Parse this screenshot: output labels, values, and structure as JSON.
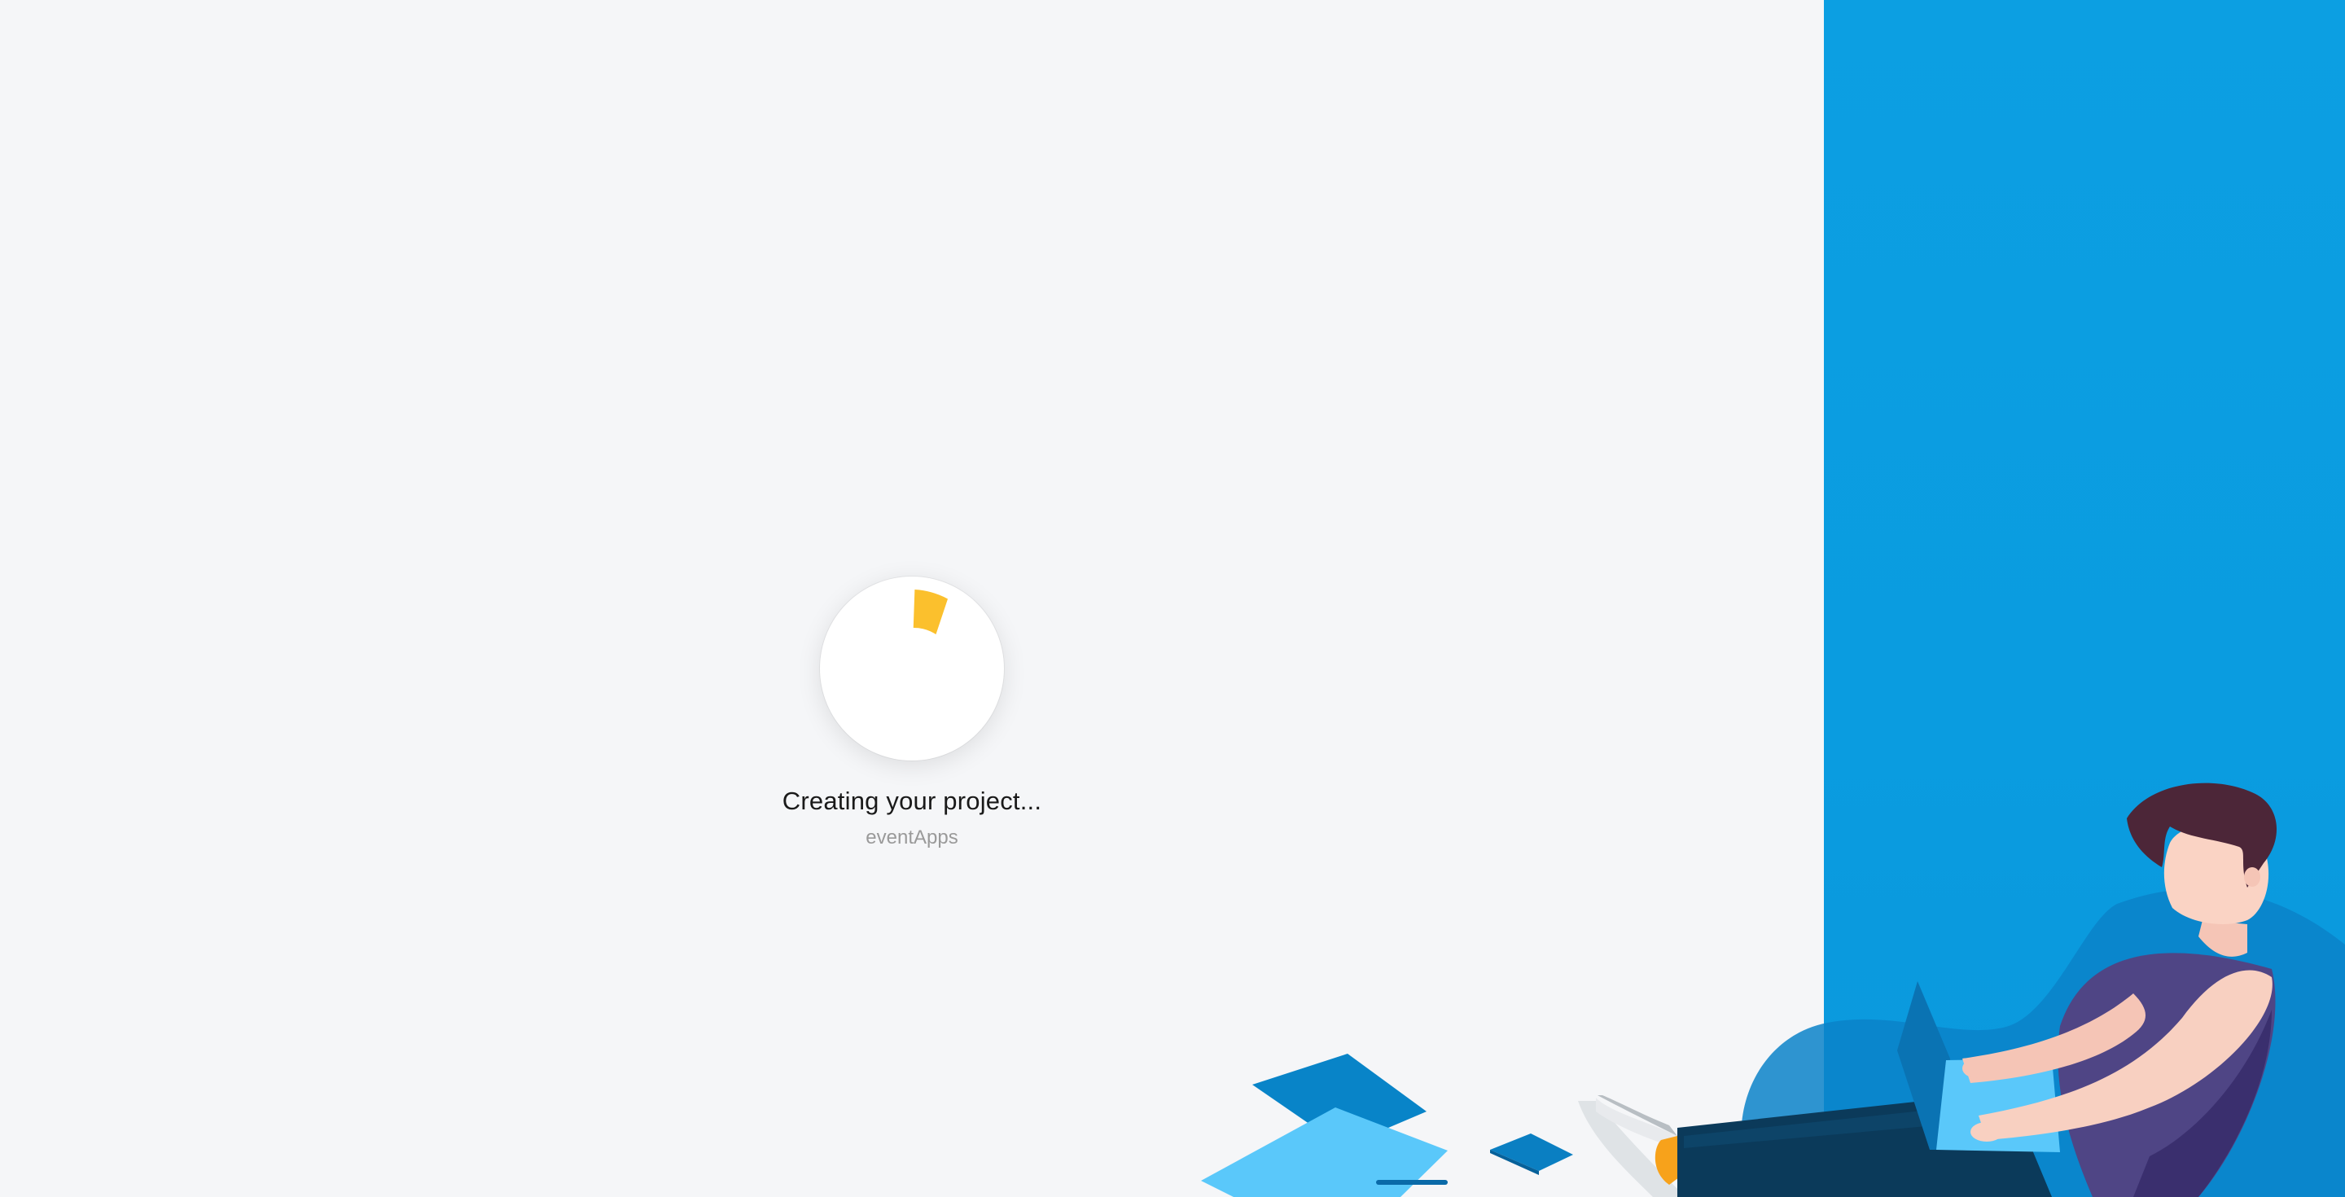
{
  "loading": {
    "title": "Creating your project...",
    "subtitle": "eventApps",
    "spinner_color": "#fbc02d"
  },
  "colors": {
    "background": "#f5f6f8",
    "side_panel": "#0c9fe2",
    "accent": "#fbc02d"
  },
  "illustration": {
    "icon": "person-with-laptop-illustration"
  }
}
